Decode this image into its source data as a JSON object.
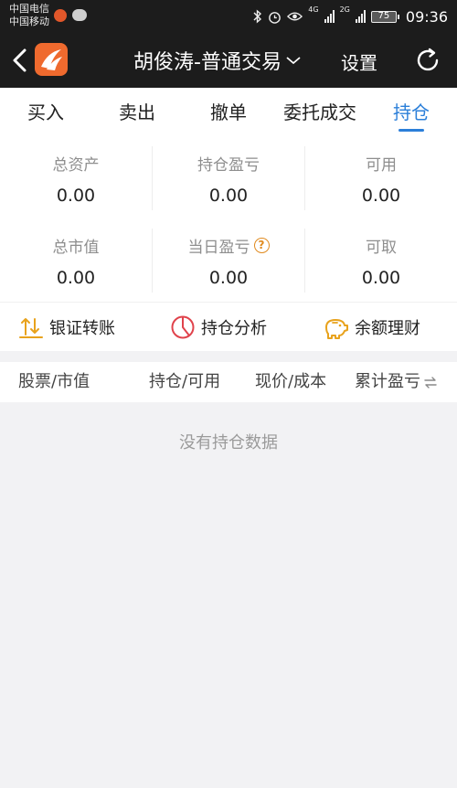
{
  "status_bar": {
    "carrier1": "中国电信",
    "carrier2": "中国移动",
    "net_label": "4G",
    "net_label2": "2G",
    "battery": "75",
    "time": "09:36"
  },
  "nav": {
    "title": "胡俊涛-普通交易",
    "settings_label": "设置",
    "icons": [
      "chevron-left-icon",
      "app-logo",
      "chevron-down-icon",
      "refresh-icon"
    ]
  },
  "tabs": [
    {
      "label": "买入",
      "active": false
    },
    {
      "label": "卖出",
      "active": false
    },
    {
      "label": "撤单",
      "active": false
    },
    {
      "label": "委托成交",
      "active": false
    },
    {
      "label": "持仓",
      "active": true
    }
  ],
  "stats": [
    {
      "label": "总资产",
      "value": "0.00"
    },
    {
      "label": "持仓盈亏",
      "value": "0.00"
    },
    {
      "label": "可用",
      "value": "0.00"
    },
    {
      "label": "总市值",
      "value": "0.00"
    },
    {
      "label": "当日盈亏",
      "value": "0.00",
      "help_icon": "?"
    },
    {
      "label": "可取",
      "value": "0.00"
    }
  ],
  "actions": [
    {
      "label": "银证转账",
      "icon": "transfer-icon"
    },
    {
      "label": "持仓分析",
      "icon": "pie-chart-icon"
    },
    {
      "label": "余额理财",
      "icon": "piggy-bank-icon"
    }
  ],
  "table": {
    "headers": [
      "股票/市值",
      "持仓/可用",
      "现价/成本",
      "累计盈亏"
    ],
    "empty_text": "没有持仓数据"
  },
  "colors": {
    "accent": "#2b7fd9",
    "brand": "#ef6a2e",
    "header_bg": "#1c1c1c",
    "muted_text": "#8e8e8e"
  }
}
